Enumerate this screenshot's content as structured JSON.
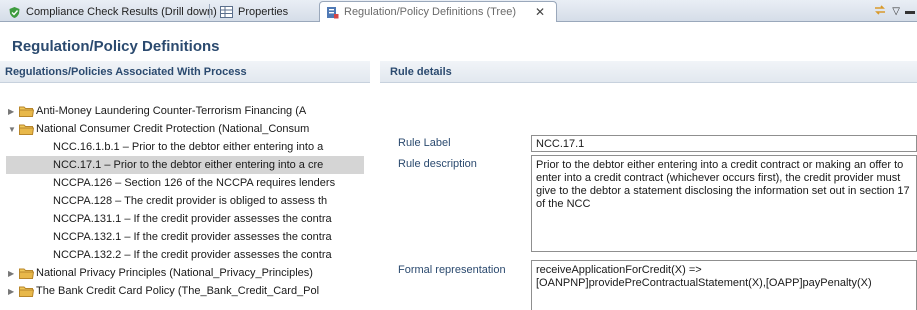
{
  "tabs": [
    {
      "label": "Compliance Check Results (Drill down)"
    },
    {
      "label": "Properties"
    },
    {
      "label": "Regulation/Policy Definitions (Tree)"
    }
  ],
  "page": {
    "title": "Regulation/Policy Definitions"
  },
  "left": {
    "header": "Regulations/Policies Associated With Process"
  },
  "right": {
    "header": "Rule details"
  },
  "tree": {
    "items": [
      {
        "label": "Anti-Money Laundering Counter-Terrorism Financing (A",
        "type": "folder",
        "expanded": false
      },
      {
        "label": "National Consumer Credit Protection (National_Consum",
        "type": "folder",
        "expanded": true
      },
      {
        "label": "NCC.16.1.b.1 – Prior to the debtor either entering into a",
        "type": "leaf"
      },
      {
        "label": "NCC.17.1 – Prior to the debtor either entering into a cre",
        "type": "leaf",
        "selected": true
      },
      {
        "label": "NCCPA.126 – Section 126 of the NCCPA requires lenders",
        "type": "leaf"
      },
      {
        "label": "NCCPA.128 – The credit provider is obliged to assess th",
        "type": "leaf"
      },
      {
        "label": "NCCPA.131.1 – If the credit provider assesses the contra",
        "type": "leaf"
      },
      {
        "label": "NCCPA.132.1 – If the credit provider assesses the contra",
        "type": "leaf"
      },
      {
        "label": "NCCPA.132.2 – If the credit provider assesses the contra",
        "type": "leaf"
      },
      {
        "label": "National Privacy Principles (National_Privacy_Principles)",
        "type": "folder",
        "expanded": false
      },
      {
        "label": "The Bank Credit Card Policy (The_Bank_Credit_Card_Pol",
        "type": "folder",
        "expanded": false
      }
    ]
  },
  "rule": {
    "label_caption": "Rule Label",
    "label_value": "NCC.17.1",
    "description_caption": "Rule description",
    "description_value": "Prior to the debtor either entering into a credit contract or making an offer to enter into a credit contract (whichever occurs first), the credit provider must give to the debtor a statement disclosing the information set out in section 17 of the NCC",
    "formal_caption": "Formal representation",
    "formal_line1": "receiveApplicationForCredit(X) =>",
    "formal_line2": "[OANPNP]providePreContractualStatement(X),[OAPP]payPenalty(X)"
  },
  "colors": {
    "accent": "#2b4a6f",
    "selection": "#d5d5d5",
    "folder": "#e8b84a"
  }
}
